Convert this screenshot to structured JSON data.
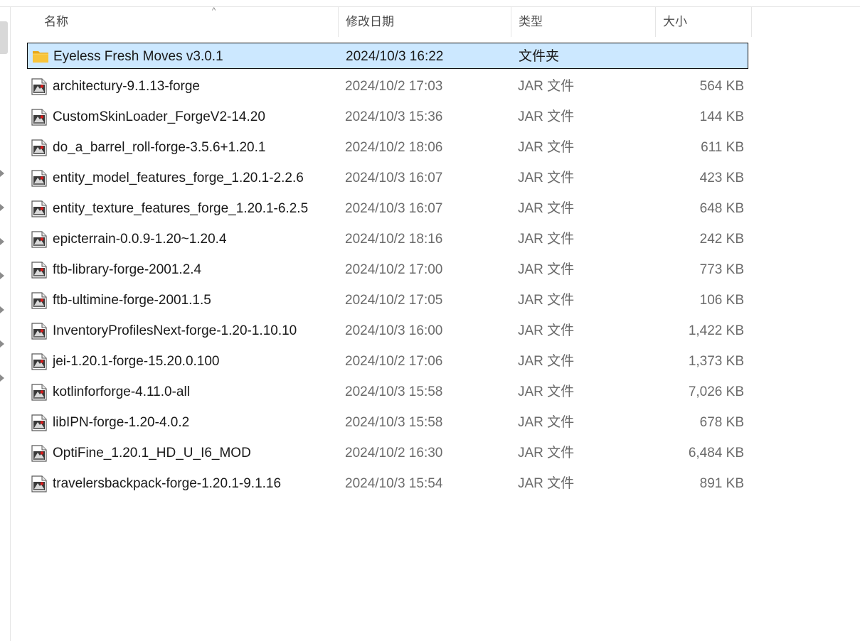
{
  "columns": {
    "name": "名称",
    "date": "修改日期",
    "type": "类型",
    "size": "大小"
  },
  "sort": {
    "column": "name",
    "direction": "ascending",
    "indicator": "^"
  },
  "selected_index": 0,
  "files": [
    {
      "name": "Eyeless Fresh Moves v3.0.1",
      "date": "2024/10/3 16:22",
      "type": "文件夹",
      "size": "",
      "icon": "folder-icon"
    },
    {
      "name": "architectury-9.1.13-forge",
      "date": "2024/10/2 17:03",
      "type": "JAR 文件",
      "size": "564 KB",
      "icon": "jar-file-icon"
    },
    {
      "name": "CustomSkinLoader_ForgeV2-14.20",
      "date": "2024/10/3 15:36",
      "type": "JAR 文件",
      "size": "144 KB",
      "icon": "jar-file-icon"
    },
    {
      "name": "do_a_barrel_roll-forge-3.5.6+1.20.1",
      "date": "2024/10/2 18:06",
      "type": "JAR 文件",
      "size": "611 KB",
      "icon": "jar-file-icon"
    },
    {
      "name": "entity_model_features_forge_1.20.1-2.2.6",
      "date": "2024/10/3 16:07",
      "type": "JAR 文件",
      "size": "423 KB",
      "icon": "jar-file-icon"
    },
    {
      "name": "entity_texture_features_forge_1.20.1-6.2.5",
      "date": "2024/10/3 16:07",
      "type": "JAR 文件",
      "size": "648 KB",
      "icon": "jar-file-icon"
    },
    {
      "name": "epicterrain-0.0.9-1.20~1.20.4",
      "date": "2024/10/2 18:16",
      "type": "JAR 文件",
      "size": "242 KB",
      "icon": "jar-file-icon"
    },
    {
      "name": "ftb-library-forge-2001.2.4",
      "date": "2024/10/2 17:00",
      "type": "JAR 文件",
      "size": "773 KB",
      "icon": "jar-file-icon"
    },
    {
      "name": "ftb-ultimine-forge-2001.1.5",
      "date": "2024/10/2 17:05",
      "type": "JAR 文件",
      "size": "106 KB",
      "icon": "jar-file-icon"
    },
    {
      "name": "InventoryProfilesNext-forge-1.20-1.10.10",
      "date": "2024/10/3 16:00",
      "type": "JAR 文件",
      "size": "1,422 KB",
      "icon": "jar-file-icon"
    },
    {
      "name": "jei-1.20.1-forge-15.20.0.100",
      "date": "2024/10/2 17:06",
      "type": "JAR 文件",
      "size": "1,373 KB",
      "icon": "jar-file-icon"
    },
    {
      "name": "kotlinforforge-4.11.0-all",
      "date": "2024/10/3 15:58",
      "type": "JAR 文件",
      "size": "7,026 KB",
      "icon": "jar-file-icon"
    },
    {
      "name": "libIPN-forge-1.20-4.0.2",
      "date": "2024/10/3 15:58",
      "type": "JAR 文件",
      "size": "678 KB",
      "icon": "jar-file-icon"
    },
    {
      "name": "OptiFine_1.20.1_HD_U_I6_MOD",
      "date": "2024/10/2 16:30",
      "type": "JAR 文件",
      "size": "6,484 KB",
      "icon": "jar-file-icon"
    },
    {
      "name": "travelersbackpack-forge-1.20.1-9.1.16",
      "date": "2024/10/3 15:54",
      "type": "JAR 文件",
      "size": "891 KB",
      "icon": "jar-file-icon"
    }
  ],
  "colors": {
    "selection_bg": "#cce8ff",
    "selection_border": "#0c0c0c",
    "folder_yellow": "#f8c43a",
    "secondary_text": "#6b6b6b"
  }
}
